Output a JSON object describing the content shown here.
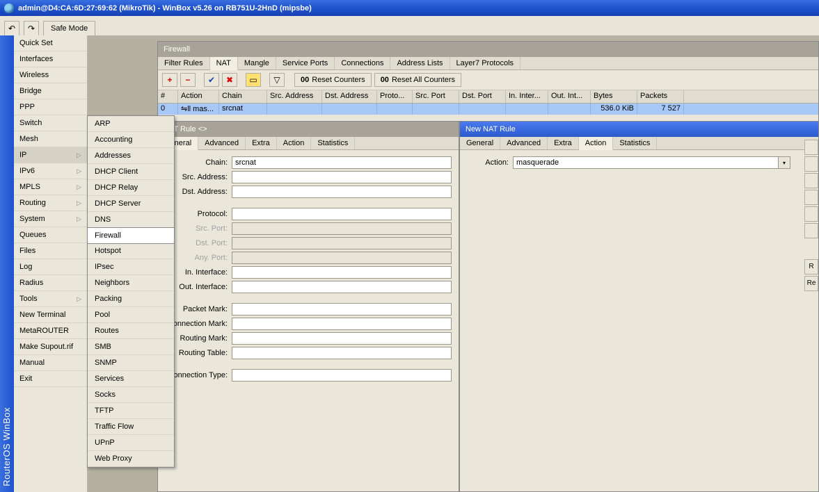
{
  "title": "admin@D4:CA:6D:27:69:62 (MikroTik) - WinBox v5.26 on RB751U-2HnD (mipsbe)",
  "toolbar": {
    "safemode": "Safe Mode"
  },
  "vtext": "RouterOS WinBox",
  "mainmenu": [
    {
      "label": "Quick Set"
    },
    {
      "label": "Interfaces"
    },
    {
      "label": "Wireless"
    },
    {
      "label": "Bridge"
    },
    {
      "label": "PPP"
    },
    {
      "label": "Switch"
    },
    {
      "label": "Mesh"
    },
    {
      "label": "IP",
      "arrow": true,
      "sel": true
    },
    {
      "label": "IPv6",
      "arrow": true
    },
    {
      "label": "MPLS",
      "arrow": true
    },
    {
      "label": "Routing",
      "arrow": true
    },
    {
      "label": "System",
      "arrow": true
    },
    {
      "label": "Queues"
    },
    {
      "label": "Files"
    },
    {
      "label": "Log"
    },
    {
      "label": "Radius"
    },
    {
      "label": "Tools",
      "arrow": true
    },
    {
      "label": "New Terminal"
    },
    {
      "label": "MetaROUTER"
    },
    {
      "label": "Make Supout.rif"
    },
    {
      "label": "Manual"
    },
    {
      "label": "Exit"
    }
  ],
  "submenu": [
    "ARP",
    "Accounting",
    "Addresses",
    "DHCP Client",
    "DHCP Relay",
    "DHCP Server",
    "DNS",
    "Firewall",
    "Hotspot",
    "IPsec",
    "Neighbors",
    "Packing",
    "Pool",
    "Routes",
    "SMB",
    "SNMP",
    "Services",
    "Socks",
    "TFTP",
    "Traffic Flow",
    "UPnP",
    "Web Proxy"
  ],
  "submenu_sel": "Firewall",
  "firewall": {
    "title": "Firewall",
    "tabs": [
      "Filter Rules",
      "NAT",
      "Mangle",
      "Service Ports",
      "Connections",
      "Address Lists",
      "Layer7 Protocols"
    ],
    "active_tab": "NAT",
    "reset1": "Reset Counters",
    "reset2": "Reset All Counters",
    "cols": [
      "#",
      "Action",
      "Chain",
      "Src. Address",
      "Dst. Address",
      "Proto...",
      "Src. Port",
      "Dst. Port",
      "In. Inter...",
      "Out. Int...",
      "Bytes",
      "Packets"
    ],
    "row": {
      "num": "0",
      "action": "⇋ll mas...",
      "chain": "srcnat",
      "bytes": "536.0 KiB",
      "packets": "7 527"
    }
  },
  "natrule": {
    "title": "NAT Rule <>",
    "tabs": [
      "General",
      "Advanced",
      "Extra",
      "Action",
      "Statistics"
    ],
    "active": "General",
    "fields": {
      "chain": {
        "l": "Chain:",
        "v": "srcnat"
      },
      "src": {
        "l": "Src. Address:"
      },
      "dst": {
        "l": "Dst. Address:"
      },
      "proto": {
        "l": "Protocol:"
      },
      "sport": {
        "l": "Src. Port:"
      },
      "dport": {
        "l": "Dst. Port:"
      },
      "aport": {
        "l": "Any. Port:"
      },
      "inif": {
        "l": "In. Interface:"
      },
      "outif": {
        "l": "Out. Interface:"
      },
      "pmark": {
        "l": "Packet Mark:"
      },
      "cmark": {
        "l": "onnection Mark:"
      },
      "rmark": {
        "l": "Routing Mark:"
      },
      "rtable": {
        "l": "Routing Table:"
      },
      "ctype": {
        "l": "onnection Type:"
      }
    }
  },
  "newnat": {
    "title": "New NAT Rule",
    "tabs": [
      "General",
      "Advanced",
      "Extra",
      "Action",
      "Statistics"
    ],
    "active": "Action",
    "action_label": "Action:",
    "action_value": "masquerade",
    "btns": [
      "R",
      "Re"
    ]
  }
}
